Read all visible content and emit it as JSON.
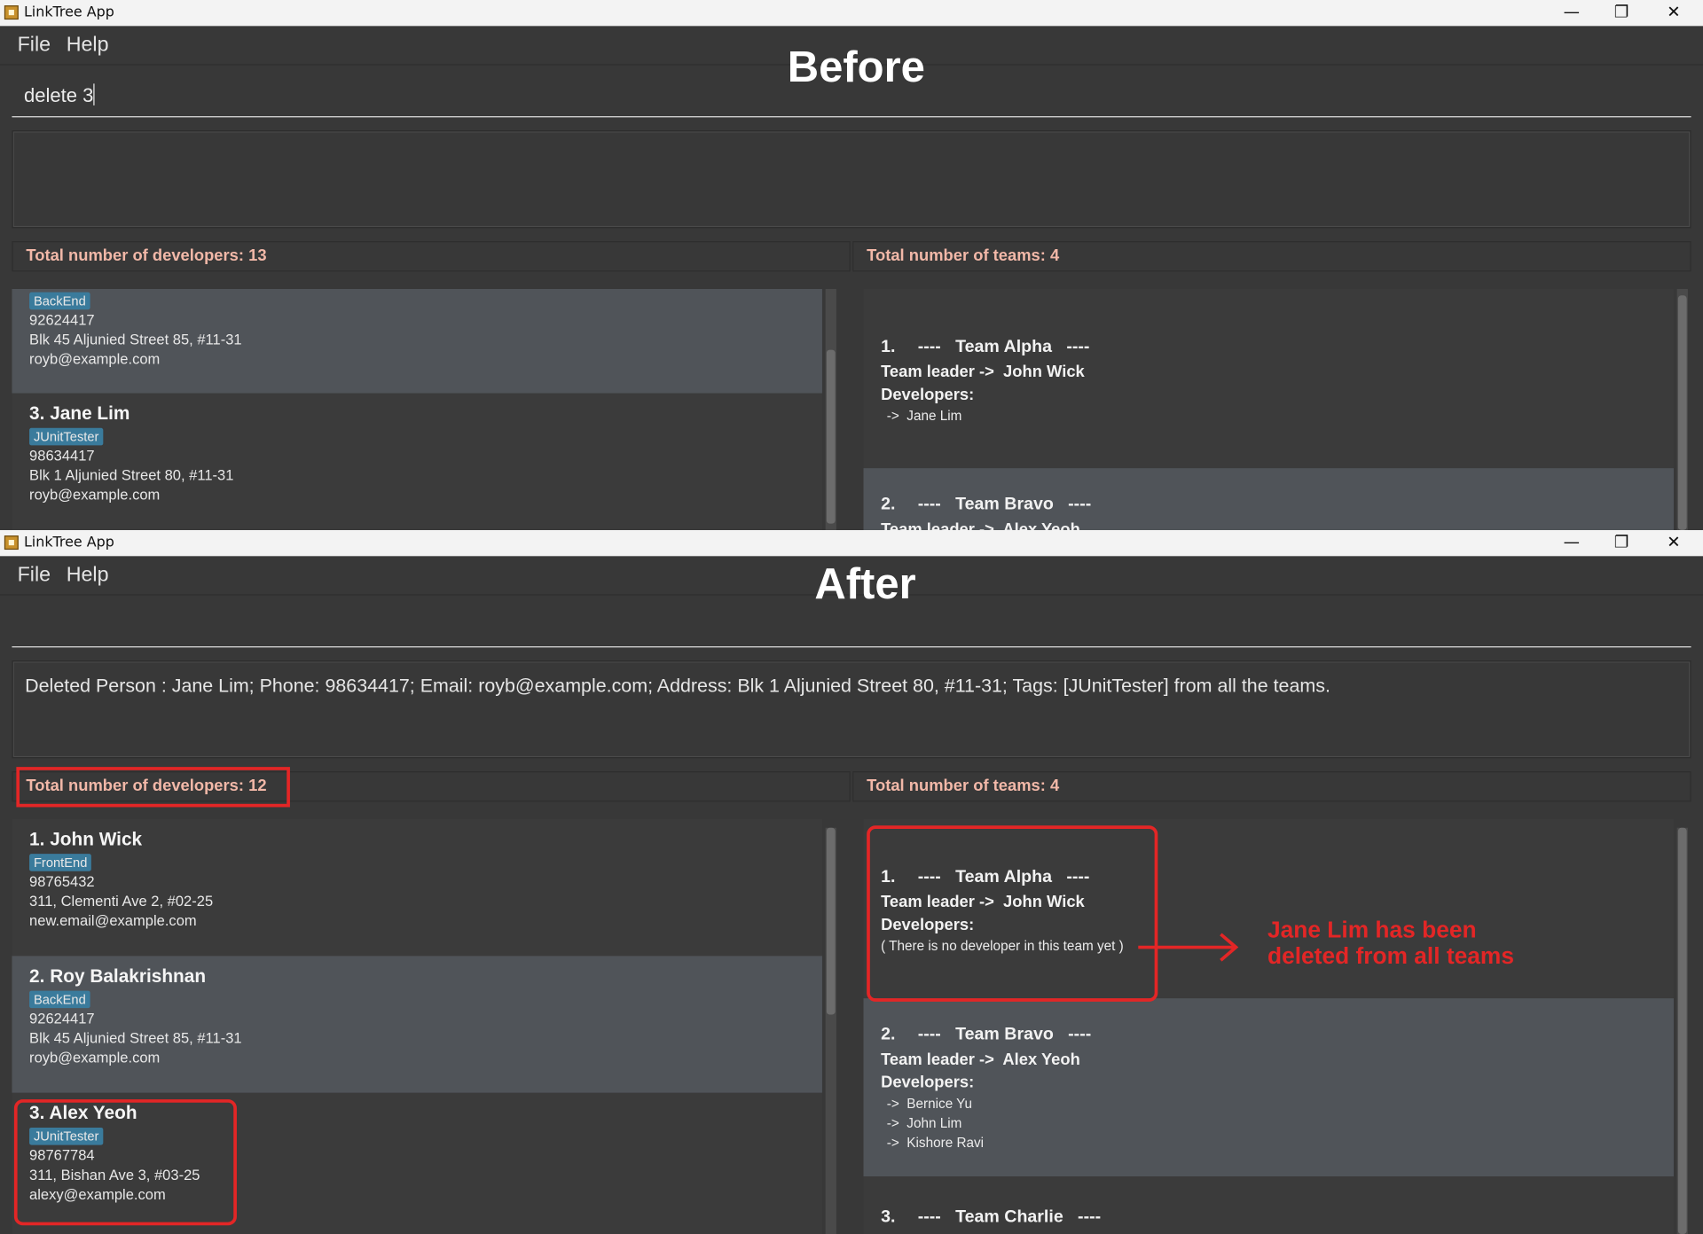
{
  "window": {
    "title": "LinkTree App",
    "controls": {
      "minimize": "—",
      "maximize": "❐",
      "close": "✕"
    }
  },
  "menu": {
    "file": "File",
    "help": "Help"
  },
  "before": {
    "banner": "Before",
    "command_input": "delete 3",
    "result": "",
    "dev_count_label": "Total number of developers: 13",
    "team_count_label": "Total number of teams: 4",
    "persons": [
      {
        "name": "",
        "tag": "BackEnd",
        "phone": "92624417",
        "address": "Blk 45 Aljunied Street 85, #11-31",
        "email": "royb@example.com"
      },
      {
        "name": "3.  Jane Lim",
        "tag": "JUnitTester",
        "phone": "98634417",
        "address": "Blk 1 Aljunied Street 80, #11-31",
        "email": "royb@example.com"
      }
    ],
    "teams": [
      {
        "index": "1.",
        "name": "----   Team Alpha   ----",
        "leader": "Team leader ->  John Wick",
        "devs_label": "Developers:",
        "devs": [
          " ->  Jane Lim"
        ]
      },
      {
        "index": "2.",
        "name": "----   Team Bravo   ----",
        "leader": "Team leader ->  Alex Yeoh"
      }
    ]
  },
  "after": {
    "banner": "After",
    "command_input": "",
    "result": "Deleted Person : Jane Lim; Phone: 98634417; Email: royb@example.com; Address: Blk 1 Aljunied Street 80, #11-31; Tags: [JUnitTester] from all the teams.",
    "dev_count_label": "Total number of developers: 12",
    "team_count_label": "Total number of teams: 4",
    "persons": [
      {
        "name": "1.  John Wick",
        "tag": "FrontEnd",
        "phone": "98765432",
        "address": "311, Clementi Ave 2, #02-25",
        "email": "new.email@example.com"
      },
      {
        "name": "2.  Roy Balakrishnan",
        "tag": "BackEnd",
        "phone": "92624417",
        "address": "Blk 45 Aljunied Street 85, #11-31",
        "email": "royb@example.com"
      },
      {
        "name": "3.  Alex Yeoh",
        "tag": "JUnitTester",
        "phone": "98767784",
        "address": "311, Bishan Ave 3, #03-25",
        "email": "alexy@example.com"
      }
    ],
    "teams": [
      {
        "index": "1.",
        "name": "----   Team Alpha   ----",
        "leader": "Team leader ->  John Wick",
        "devs_label": "Developers:",
        "devs": [
          "( There is no developer in this team yet )"
        ]
      },
      {
        "index": "2.",
        "name": "----   Team Bravo   ----",
        "leader": "Team leader ->  Alex Yeoh",
        "devs_label": "Developers:",
        "devs": [
          " ->  Bernice Yu",
          " ->  John Lim",
          " ->  Kishore Ravi"
        ]
      },
      {
        "index": "3.",
        "name": "----   Team Charlie   ----"
      }
    ]
  },
  "annotation": {
    "line1": "Jane Lim has been",
    "line2": "deleted from all teams",
    "color": "#e32626"
  }
}
